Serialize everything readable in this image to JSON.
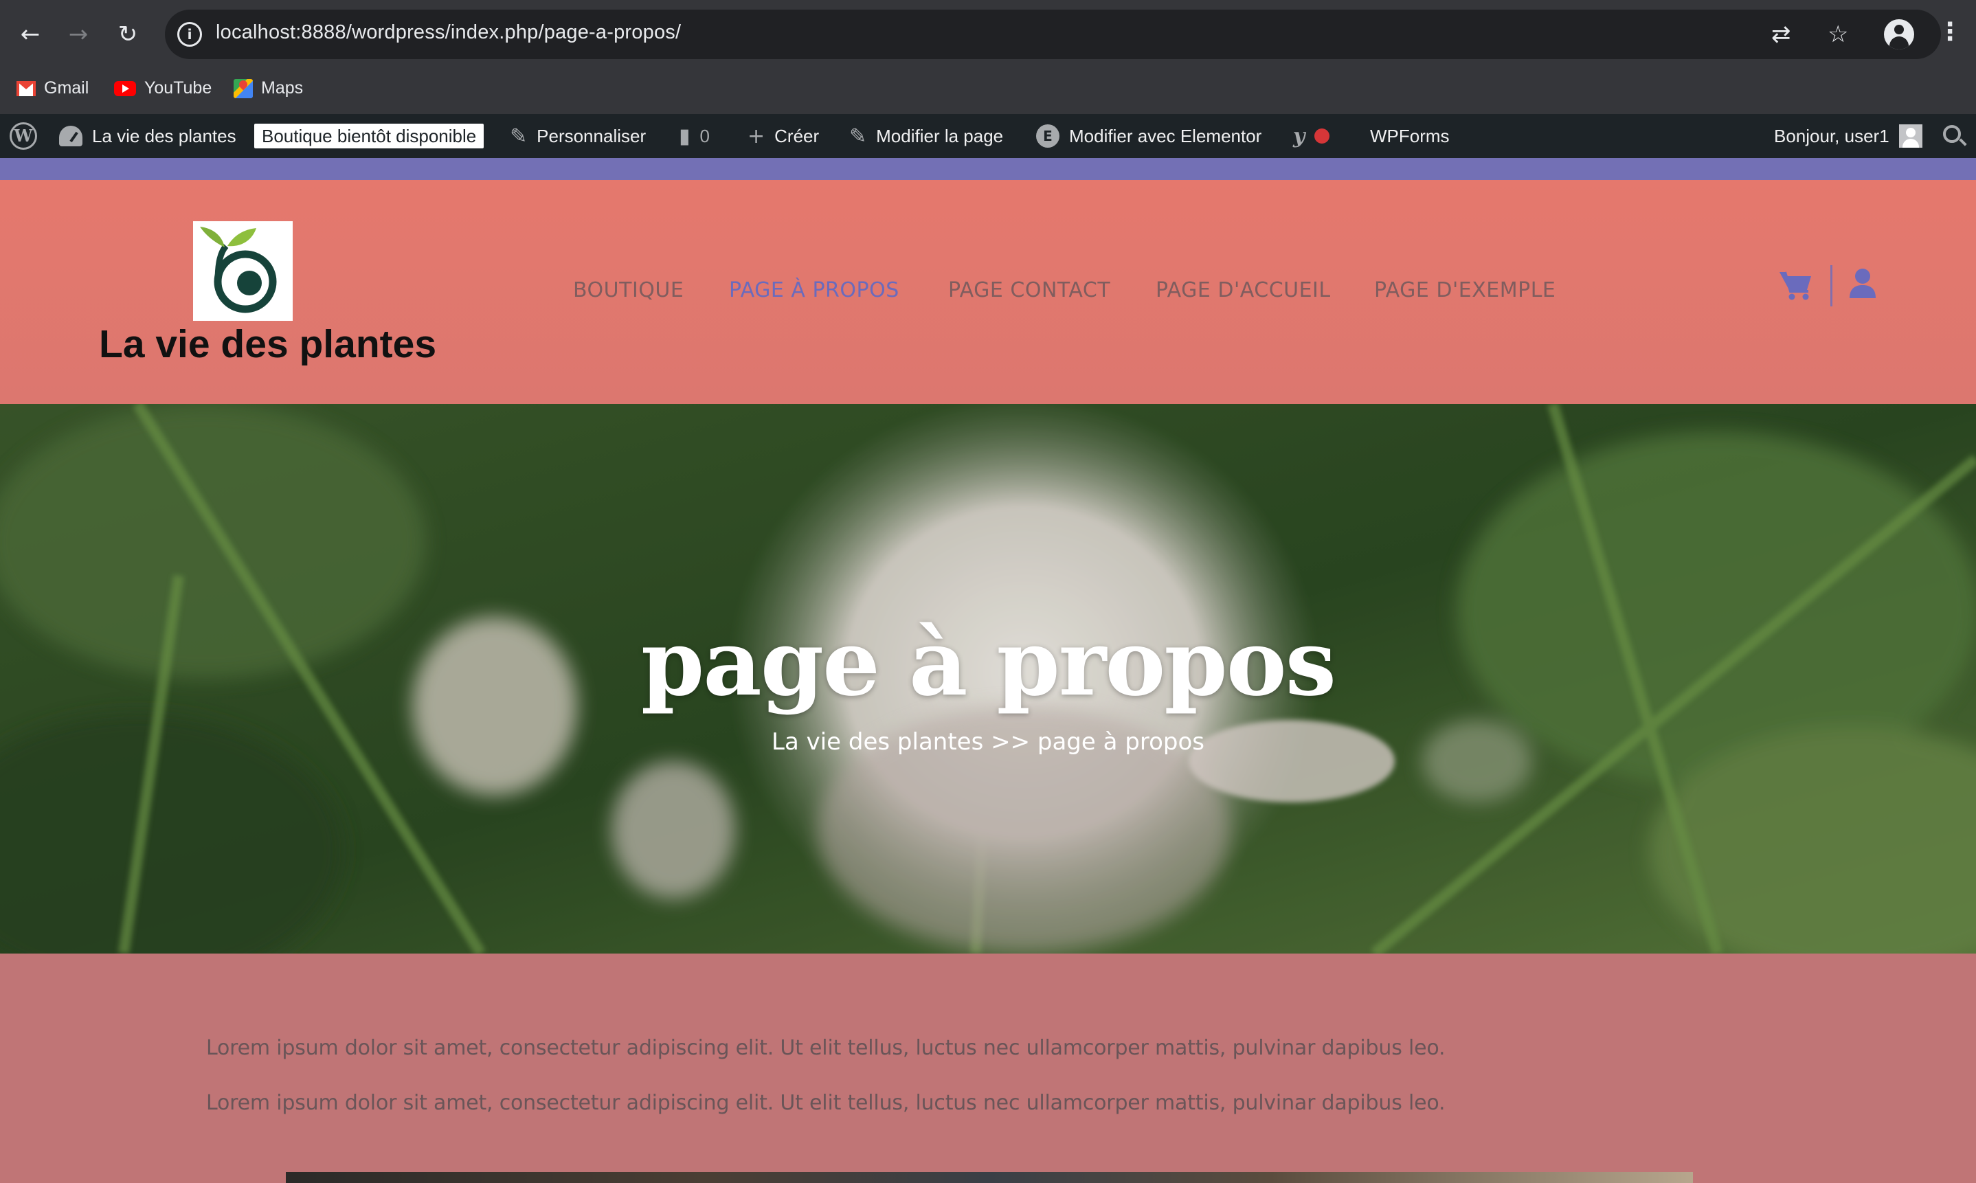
{
  "browser": {
    "url": "localhost:8888/wordpress/index.php/page-a-propos/",
    "bookmarks": [
      {
        "label": "Gmail",
        "icon": "gmail-icon"
      },
      {
        "label": "YouTube",
        "icon": "youtube-icon"
      },
      {
        "label": "Maps",
        "icon": "maps-icon"
      }
    ]
  },
  "adminbar": {
    "site_name": "La vie des plantes",
    "shop_badge": "Boutique bientôt disponible",
    "customize": "Personnaliser",
    "comments_count": "0",
    "create": "Créer",
    "edit_page": "Modifier la page",
    "edit_elementor": "Modifier avec Elementor",
    "wpforms": "WPForms",
    "greeting": "Bonjour, user1"
  },
  "header": {
    "site_title": "La vie des plantes",
    "menu": [
      {
        "label": "BOUTIQUE",
        "active": false
      },
      {
        "label": "PAGE À PROPOS",
        "active": true
      },
      {
        "label": "PAGE CONTACT",
        "active": false
      },
      {
        "label": "PAGE D'ACCUEIL",
        "active": false
      },
      {
        "label": "PAGE D'EXEMPLE",
        "active": false
      }
    ],
    "accent_color": "#6a6bbd"
  },
  "hero": {
    "title": "page à propos",
    "breadcrumb": "La vie des plantes >> page à propos"
  },
  "content": {
    "paragraphs": [
      "Lorem ipsum dolor sit amet, consectetur adipiscing elit. Ut elit tellus, luctus nec ullamcorper mattis, pulvinar dapibus leo.",
      "Lorem ipsum dolor sit amet, consectetur adipiscing elit. Ut elit tellus, luctus nec ullamcorper mattis, pulvinar dapibus leo."
    ]
  }
}
